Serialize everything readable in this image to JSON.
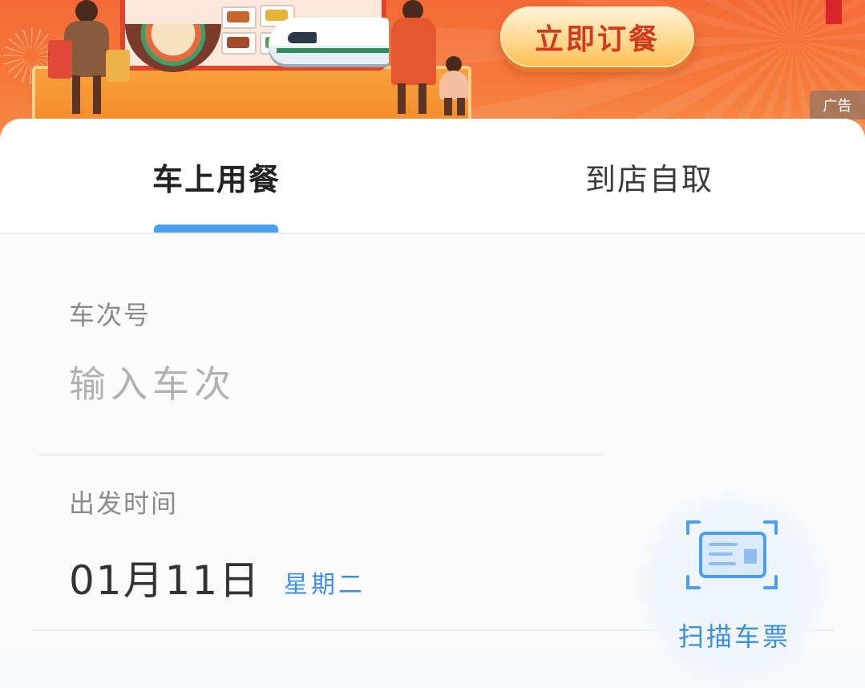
{
  "banner": {
    "order_button_label": "立即订餐",
    "ad_label": "广告"
  },
  "tabs": [
    {
      "label": "车上用餐",
      "active": true
    },
    {
      "label": "到店自取",
      "active": false
    }
  ],
  "form": {
    "train_number": {
      "label": "车次号",
      "placeholder": "输入车次",
      "value": ""
    },
    "departure": {
      "label": "出发时间",
      "date": "01月11日",
      "weekday": "星期二"
    },
    "scan_ticket_label": "扫描车票"
  },
  "colors": {
    "banner_orange": "#f46a36",
    "accent_blue": "#4a9ff0",
    "link_blue": "#3b8fe0",
    "button_text_red": "#d23a1f"
  },
  "icons": [
    "ticket-scan-icon"
  ]
}
